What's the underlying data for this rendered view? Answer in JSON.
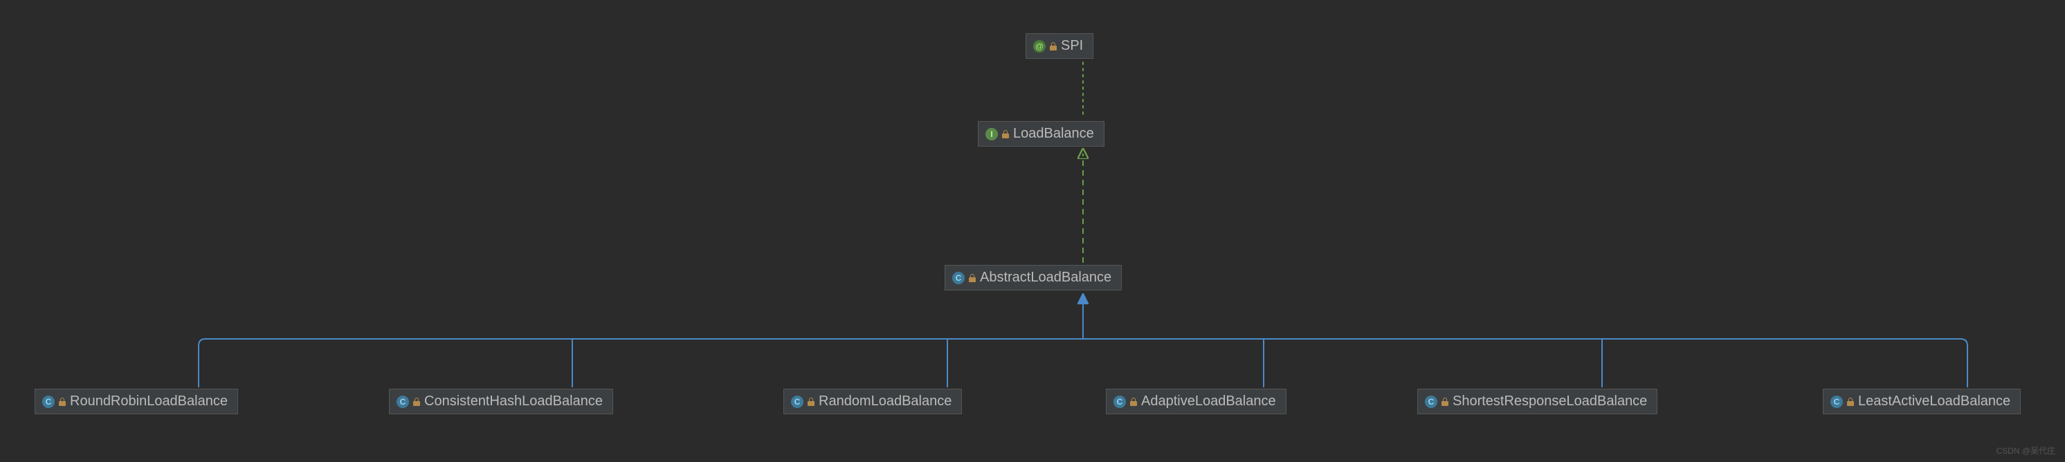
{
  "diagram": {
    "root": {
      "name": "SPI",
      "type": "annotation"
    },
    "level1": {
      "name": "LoadBalance",
      "type": "interface"
    },
    "level2": {
      "name": "AbstractLoadBalance",
      "type": "class"
    },
    "leaves": [
      {
        "name": "RoundRobinLoadBalance",
        "type": "class"
      },
      {
        "name": "ConsistentHashLoadBalance",
        "type": "class"
      },
      {
        "name": "RandomLoadBalance",
        "type": "class"
      },
      {
        "name": "AdaptiveLoadBalance",
        "type": "class"
      },
      {
        "name": "ShortestResponseLoadBalance",
        "type": "class"
      },
      {
        "name": "LeastActiveLoadBalance",
        "type": "class"
      }
    ]
  },
  "watermark": "CSDN @吴代庄"
}
